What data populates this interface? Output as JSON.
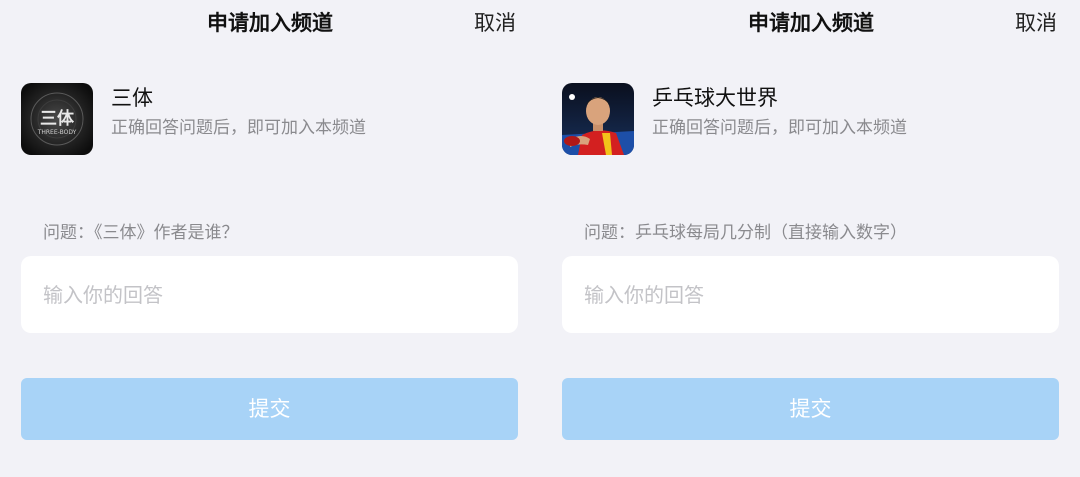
{
  "colors": {
    "background": "#f2f2f7",
    "submit_button": "#a8d3f7",
    "secondary_text": "#8a8a8e",
    "placeholder_text": "#c3c3c7"
  },
  "panels": [
    {
      "header": {
        "title": "申请加入频道",
        "cancel_label": "取消"
      },
      "channel": {
        "avatar_icon": "three-body-logo-icon",
        "avatar_logo_text": "三体",
        "avatar_logo_subtext": "THREE-BODY",
        "name": "三体",
        "description": "正确回答问题后，即可加入本频道"
      },
      "question": "问题：《三体》作者是谁？",
      "answer": {
        "value": "",
        "placeholder": "输入你的回答"
      },
      "submit_label": "提交"
    },
    {
      "header": {
        "title": "申请加入频道",
        "cancel_label": "取消"
      },
      "channel": {
        "avatar_icon": "table-tennis-player-photo-icon",
        "name": "乒乓球大世界",
        "description": "正确回答问题后，即可加入本频道"
      },
      "question": "问题：乒乓球每局几分制（直接输入数字）",
      "answer": {
        "value": "",
        "placeholder": "输入你的回答"
      },
      "submit_label": "提交"
    }
  ]
}
